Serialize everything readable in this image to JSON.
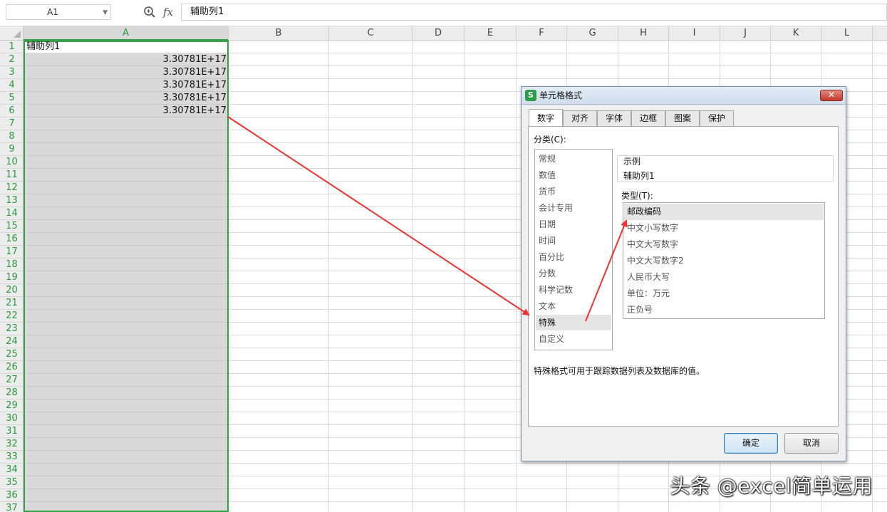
{
  "formula_bar": {
    "cell_ref": "A1",
    "fx_label": "fx",
    "formula_value": "辅助列1"
  },
  "sheet": {
    "columns": [
      "A",
      "B",
      "C",
      "D",
      "E",
      "F",
      "G",
      "H",
      "I",
      "J",
      "K",
      "L"
    ],
    "selected_column": "A",
    "rows": [
      "1",
      "2",
      "3",
      "4",
      "5",
      "6",
      "7",
      "8",
      "9",
      "10",
      "11",
      "12",
      "13",
      "14",
      "15",
      "16",
      "17",
      "18",
      "19",
      "20",
      "21",
      "22",
      "23",
      "24",
      "25",
      "26",
      "27",
      "28",
      "29",
      "30",
      "31",
      "32",
      "33",
      "34",
      "35",
      "36",
      "37"
    ],
    "cells": {
      "A1": "辅助列1",
      "A2": "3.30781E+17",
      "A3": "3.30781E+17",
      "A4": "3.30781E+17",
      "A5": "3.30781E+17",
      "A6": "3.30781E+17"
    },
    "colors": {
      "selection_border": "#35a04a",
      "selection_fill": "#d9d9d9"
    }
  },
  "dialog": {
    "title": "单元格格式",
    "logo_glyph": "S",
    "close_glyph": "✕",
    "tabs": [
      {
        "label": "数字",
        "active": true
      },
      {
        "label": "对齐",
        "active": false
      },
      {
        "label": "字体",
        "active": false
      },
      {
        "label": "边框",
        "active": false
      },
      {
        "label": "图案",
        "active": false
      },
      {
        "label": "保护",
        "active": false
      }
    ],
    "category_label": "分类(C):",
    "categories": [
      "常规",
      "数值",
      "货币",
      "会计专用",
      "日期",
      "时间",
      "百分比",
      "分数",
      "科学记数",
      "文本",
      "特殊",
      "自定义"
    ],
    "selected_category": "特殊",
    "sample_label": "示例",
    "sample_value": "辅助列1",
    "type_label": "类型(T):",
    "types": [
      "邮政编码",
      "中文小写数字",
      "中文大写数字",
      "中文大写数字2",
      "人民币大写",
      "单位：万元",
      "正负号"
    ],
    "selected_type": "邮政编码",
    "description": "特殊格式可用于跟踪数据列表及数据库的值。",
    "ok_label": "确定",
    "cancel_label": "取消"
  },
  "annotations": {
    "arrow_color": "#ee3333"
  },
  "watermark": "头条 @excel简单运用"
}
